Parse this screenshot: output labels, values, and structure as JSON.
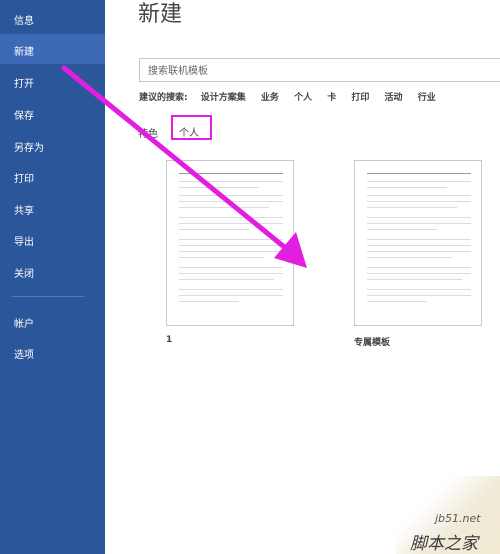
{
  "sidebar": {
    "items": [
      {
        "label": "信息"
      },
      {
        "label": "新建"
      },
      {
        "label": "打开"
      },
      {
        "label": "保存"
      },
      {
        "label": "另存为"
      },
      {
        "label": "打印"
      },
      {
        "label": "共享"
      },
      {
        "label": "导出"
      },
      {
        "label": "关闭"
      }
    ],
    "footer_items": [
      {
        "label": "帐户"
      },
      {
        "label": "选项"
      }
    ],
    "active": "新建"
  },
  "main": {
    "title": "新建",
    "search": {
      "placeholder": "搜索联机模板",
      "value": ""
    },
    "suggestions": {
      "label": "建议的搜索:",
      "links": [
        "设计方案集",
        "业务",
        "个人",
        "卡",
        "打印",
        "活动",
        "行业"
      ]
    },
    "tabs": [
      {
        "label": "特色"
      },
      {
        "label": "个人"
      }
    ],
    "templates": [
      {
        "name": "1"
      },
      {
        "name": "专属模板"
      }
    ]
  },
  "colors": {
    "sidebar_bg": "#2b579a",
    "highlight_box": "#e21ee0",
    "arrow": "#e21ee0"
  },
  "watermark": {
    "url": "jb51.net",
    "site": "脚本之家"
  }
}
